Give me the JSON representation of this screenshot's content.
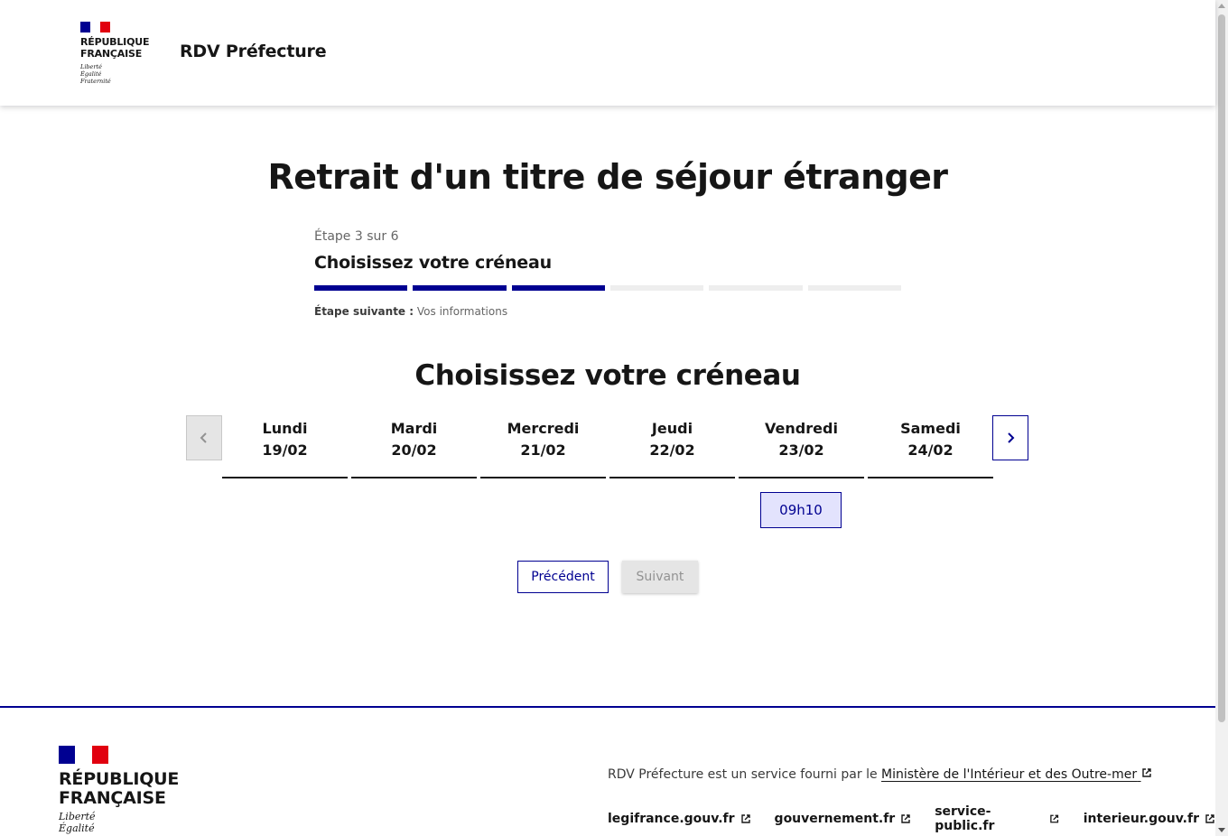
{
  "header": {
    "rf_name_line1": "RÉPUBLIQUE",
    "rf_name_line2": "FRANÇAISE",
    "motto_line1": "Liberté",
    "motto_line2": "Égalité",
    "motto_line3": "Fraternité",
    "service_title": "RDV Préfecture"
  },
  "main": {
    "page_title": "Retrait d'un titre de séjour étranger",
    "stepper": {
      "state": "Étape 3 sur 6",
      "title": "Choisissez votre créneau",
      "next_label": "Étape suivante :",
      "next_value": " Vos informations",
      "steps_total": 6,
      "steps_done": 3
    },
    "section_title": "Choisissez votre créneau",
    "calendar": {
      "prev_icon": "chevron-left-icon",
      "next_icon": "chevron-right-icon",
      "days": [
        {
          "name": "Lundi",
          "date": "19/02"
        },
        {
          "name": "Mardi",
          "date": "20/02"
        },
        {
          "name": "Mercredi",
          "date": "21/02"
        },
        {
          "name": "Jeudi",
          "date": "22/02"
        },
        {
          "name": "Vendredi",
          "date": "23/02"
        },
        {
          "name": "Samedi",
          "date": "24/02"
        }
      ],
      "slot": "09h10"
    },
    "buttons": {
      "previous": "Précédent",
      "next": "Suivant"
    }
  },
  "footer": {
    "rf_name_line1": "RÉPUBLIQUE",
    "rf_name_line2": "FRANÇAISE",
    "motto_line1": "Liberté",
    "motto_line2": "Égalité",
    "description_prefix": "RDV Préfecture est un service fourni par le ",
    "ministry_link": "Ministère de l'Intérieur et des Outre-mer",
    "links": [
      "legifrance.gouv.fr",
      "gouvernement.fr",
      "service-public.fr",
      "interieur.gouv.fr"
    ]
  },
  "colors": {
    "primary": "#000091",
    "marianne_red": "#e1000f",
    "slot_bg": "#e3e3fd",
    "disabled_bg": "#e5e5e5"
  }
}
